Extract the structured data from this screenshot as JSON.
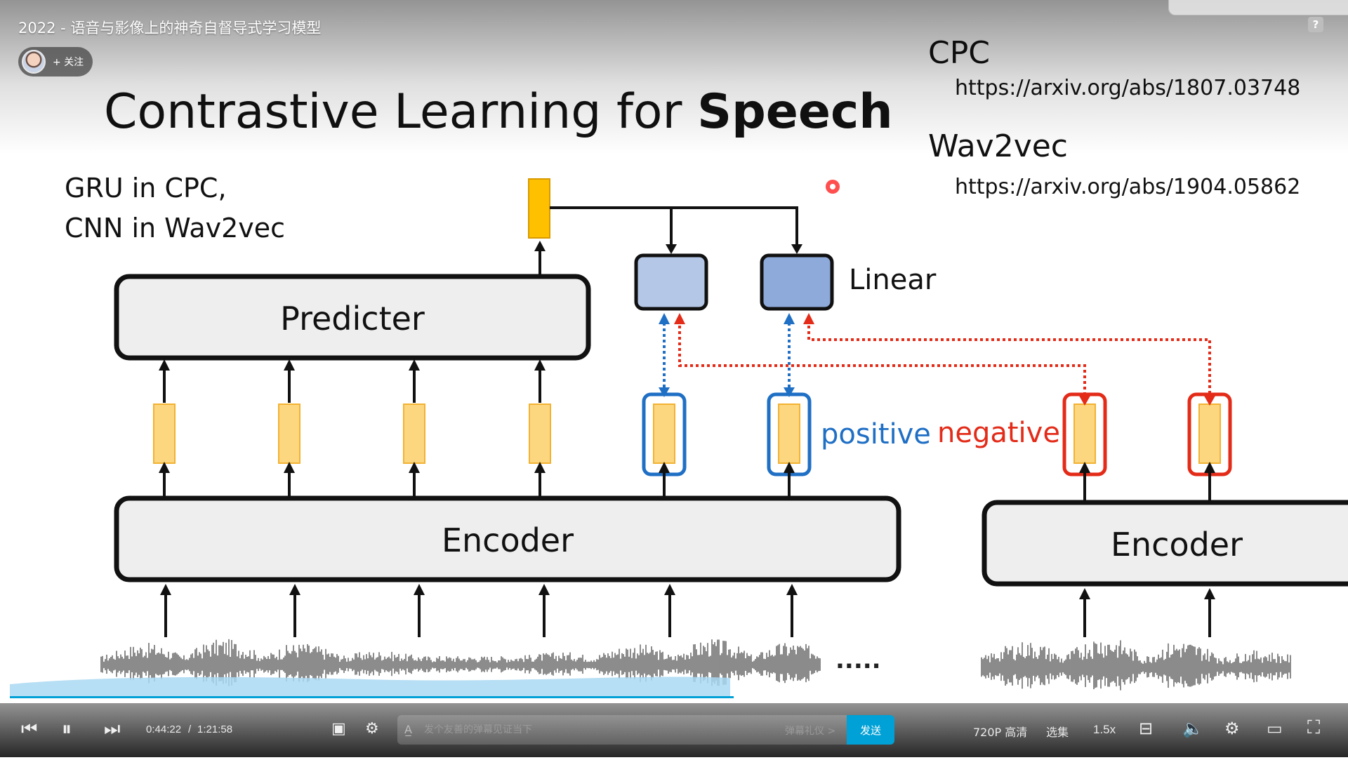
{
  "player": {
    "video_title": "2022 - 语音与影像上的神奇自督导式学习模型",
    "follow_label": "+ 关注",
    "time_current": "0:44:22",
    "time_separator": "/",
    "time_total": "1:21:58",
    "danmaku_placeholder": "发个友善的弹幕见证当下",
    "danmaku_etiquette": "弹幕礼仪 >",
    "send_label": "发送",
    "quality_label": "720P 高清",
    "episodes_label": "选集",
    "speed_label": "1.5x",
    "progress_fraction": 0.541,
    "accent_color": "#00a1d6",
    "icons": [
      "prev-icon",
      "pause-icon",
      "next-icon",
      "danmaku-toggle-icon",
      "danmaku-settings-icon",
      "subtitle-off-icon",
      "volume-icon",
      "settings-icon",
      "pip-icon",
      "fullscreen-icon",
      "help-icon"
    ]
  },
  "slide": {
    "title_regular": "Contrastive Learning for ",
    "title_bold": "Speech",
    "note_line1": "GRU in CPC,",
    "note_line2": "CNN in Wav2vec",
    "cpc_label": "CPC",
    "cpc_url": "https://arxiv.org/abs/1807.03748",
    "wav2vec_label": "Wav2vec",
    "wav2vec_url": "https://arxiv.org/abs/1904.05862",
    "predicter_label": "Predicter",
    "encoder_left_label": "Encoder",
    "encoder_right_label": "Encoder",
    "linear_label": "Linear",
    "positive_label": "positive",
    "negative_label": "negative",
    "ellipsis": ".....",
    "colors": {
      "token_fill": "#fcd780",
      "token_stroke": "#f2b233",
      "context_fill": "#ffc000",
      "linear1_fill": "#b4c7e7",
      "linear2_fill": "#8eaadb",
      "positive": "#1f6fc5",
      "negative": "#e32b18",
      "box_fill": "#eeeeee"
    }
  }
}
